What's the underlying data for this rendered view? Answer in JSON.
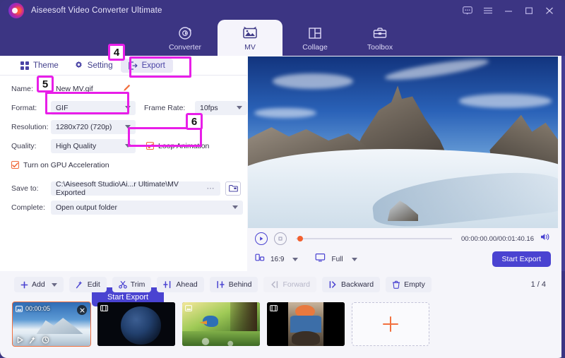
{
  "window": {
    "app_title": "Aiseesoft Video Converter Ultimate",
    "logo": "aiseesoft-logo",
    "buttons": [
      {
        "name": "feedback-icon",
        "label": "Feedback"
      },
      {
        "name": "menu-icon",
        "label": "Menu"
      },
      {
        "name": "minimize-icon",
        "label": "Minimize"
      },
      {
        "name": "maximize-icon",
        "label": "Maximize"
      },
      {
        "name": "close-icon",
        "label": "Close"
      }
    ]
  },
  "main_nav": {
    "tabs": [
      {
        "label": "Converter",
        "icon": "converter-icon",
        "active": false
      },
      {
        "label": "MV",
        "icon": "mv-image-icon",
        "active": true
      },
      {
        "label": "Collage",
        "icon": "collage-icon",
        "active": false
      },
      {
        "label": "Toolbox",
        "icon": "toolbox-icon",
        "active": false
      }
    ]
  },
  "sub_tabs": {
    "items": [
      {
        "label": "Theme",
        "icon": "grid-icon",
        "active": false
      },
      {
        "label": "Setting",
        "icon": "gear-icon",
        "active": false
      },
      {
        "label": "Export",
        "icon": "export-icon",
        "active": true
      }
    ]
  },
  "export_form": {
    "name_label": "Name:",
    "name_value": "New MV.gif",
    "edit_icon": "pencil-icon",
    "format_label": "Format:",
    "format_value": "GIF",
    "frame_rate_label": "Frame Rate:",
    "frame_rate_value": "10fps",
    "resolution_label": "Resolution:",
    "resolution_value": "1280x720 (720p)",
    "quality_label": "Quality:",
    "quality_value": "High Quality",
    "loop_animation_label": "Loop Animation",
    "loop_animation_checked": true,
    "gpu_label": "Turn on GPU Acceleration",
    "gpu_checked": true,
    "save_to_label": "Save to:",
    "save_to_value": "C:\\Aiseesoft Studio\\Ai...r Ultimate\\MV Exported",
    "browse_dots": "• • •",
    "folder_icon": "folder-icon",
    "complete_label": "Complete:",
    "complete_value": "Open output folder",
    "start_export_label": "Start Export"
  },
  "preview": {
    "description": "Snowy mountain peaks under blue sky",
    "play_icon": "play-icon",
    "stop_icon": "stop-icon",
    "timecode": "00:00:00.00/00:01:40.16",
    "volume_icon": "volume-icon",
    "aspect_icon": "aspect-ratio-icon",
    "aspect_value": "16:9",
    "screen_icon": "screen-icon",
    "screen_value": "Full",
    "start_export_label": "Start Export"
  },
  "toolbar": {
    "buttons": [
      {
        "label": "Add",
        "icon": "plus-icon",
        "has_caret": true,
        "disabled": false
      },
      {
        "label": "Edit",
        "icon": "magic-wand-icon",
        "has_caret": false,
        "disabled": false
      },
      {
        "label": "Trim",
        "icon": "scissors-icon",
        "has_caret": false,
        "disabled": false
      },
      {
        "label": "Ahead",
        "icon": "insert-ahead-icon",
        "has_caret": false,
        "disabled": false
      },
      {
        "label": "Behind",
        "icon": "insert-behind-icon",
        "has_caret": false,
        "disabled": false
      },
      {
        "label": "Forward",
        "icon": "move-forward-icon",
        "has_caret": false,
        "disabled": true
      },
      {
        "label": "Backward",
        "icon": "move-backward-icon",
        "has_caret": false,
        "disabled": false
      },
      {
        "label": "Empty",
        "icon": "trash-icon",
        "has_caret": false,
        "disabled": false
      }
    ],
    "pager": "1 / 4"
  },
  "filmstrip": {
    "clips": [
      {
        "name": "clip-mountain",
        "duration": "00:00:05",
        "selected": true,
        "type": "image"
      },
      {
        "name": "clip-planet",
        "duration": "",
        "selected": false,
        "type": "video"
      },
      {
        "name": "clip-bird",
        "duration": "",
        "selected": false,
        "type": "image"
      },
      {
        "name": "clip-person",
        "duration": "",
        "selected": false,
        "type": "video"
      }
    ],
    "add_label": "+",
    "clip_tools": [
      "play-icon",
      "magic-wand-icon",
      "clock-icon"
    ],
    "close_icon": "close-icon"
  },
  "annotations": {
    "callouts": [
      {
        "number": "4",
        "target": "export-subtab"
      },
      {
        "number": "5",
        "target": "format-select"
      },
      {
        "number": "6",
        "target": "loop-animation-checkbox"
      }
    ],
    "highlight_color": "#e81ee8"
  }
}
